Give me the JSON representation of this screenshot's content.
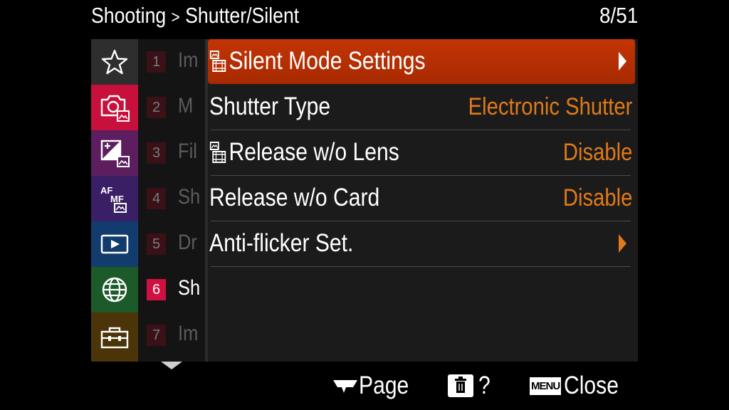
{
  "header": {
    "category": "Shooting",
    "separator": ">",
    "page": "Shutter/Silent",
    "counter": "8/51"
  },
  "tabs": [
    {
      "name": "star-icon",
      "color": "#2e2e2e"
    },
    {
      "name": "camera-photo-icon",
      "color": "#c8103c"
    },
    {
      "name": "exposure-color-icon",
      "color": "#5c1e5e"
    },
    {
      "name": "af-mf-icon",
      "color": "#3a1f66"
    },
    {
      "name": "playback-icon",
      "color": "#133c6e"
    },
    {
      "name": "network-globe-icon",
      "color": "#1d5a2a"
    },
    {
      "name": "toolbox-setup-icon",
      "color": "#4a3408"
    }
  ],
  "submenu": [
    {
      "num": "1",
      "label": "Im"
    },
    {
      "num": "2",
      "label": "M"
    },
    {
      "num": "3",
      "label": "Fil"
    },
    {
      "num": "4",
      "label": "Sh"
    },
    {
      "num": "5",
      "label": "Dr"
    },
    {
      "num": "6",
      "label": "Sh",
      "active": true
    },
    {
      "num": "7",
      "label": "Im"
    }
  ],
  "rows": [
    {
      "label": "Silent Mode Settings",
      "value": "",
      "arrow": true,
      "selected": true,
      "icon": "photo-movie-icon"
    },
    {
      "label": "Shutter Type",
      "value": "Electronic Shutter"
    },
    {
      "label": "Release w/o Lens",
      "value": "Disable",
      "icon": "photo-movie-icon"
    },
    {
      "label": "Release w/o Card",
      "value": "Disable"
    },
    {
      "label": "Anti-flicker Set.",
      "value": "",
      "arrow": true
    }
  ],
  "footer": {
    "page_label": "Page",
    "help_label": "?",
    "menu_badge": "MENU",
    "close_label": "Close"
  },
  "colors": {
    "accent": "#e07a1a",
    "selection": "#b32e03",
    "active_tab": "#d01040"
  }
}
